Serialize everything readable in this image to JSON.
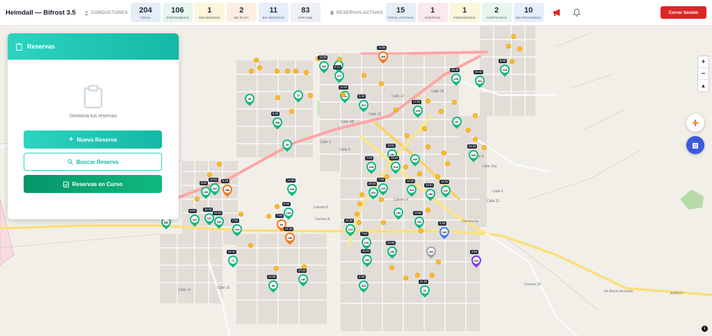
{
  "header": {
    "title": "Heimdall — Bifrost 3.5",
    "drivers_label": "CONDUCTORES",
    "reservations_label": "RESERVAS ACTIVAS",
    "driver_stats": [
      {
        "value": "204",
        "label": "TOTAL",
        "color": "#e5edf7"
      },
      {
        "value": "106",
        "label": "DISPONIBLES",
        "color": "#e6f6ec"
      },
      {
        "value": "1",
        "label": "RECIBIENDO",
        "color": "#fbf6dc"
      },
      {
        "value": "2",
        "label": "EN RUTA",
        "color": "#fdeee2"
      },
      {
        "value": "11",
        "label": "EN SERVICIO",
        "color": "#e6edfb"
      },
      {
        "value": "83",
        "label": "OFFLINE",
        "color": "#eef0f3"
      }
    ],
    "reservation_stats": [
      {
        "value": "15",
        "label": "TOTAL ACTIVAS",
        "color": "#e5edf7"
      },
      {
        "value": "1",
        "label": "OFERTAS",
        "color": "#fbe7ee"
      },
      {
        "value": "1",
        "label": "PENDIENTES",
        "color": "#fbf6dc"
      },
      {
        "value": "2",
        "label": "ACEPTADAS",
        "color": "#e6f6ec"
      },
      {
        "value": "10",
        "label": "EN PROGRESO",
        "color": "#e6edfb"
      }
    ],
    "logout_label": "Cerrar Sesión"
  },
  "panel": {
    "title": "Reservas",
    "subtitle": "Gestiona tus reservas",
    "new_label": "Nueva Reserva",
    "search_label": "Buscar Reserva",
    "progress_label": "Reservas en Curso"
  },
  "map": {
    "zoom_in": "+",
    "zoom_out": "−",
    "north": "▲",
    "attribution": "i",
    "road_labels": [
      "Carrera 8",
      "Carrera 6",
      "Carrera 4",
      "Calle 5",
      "Calle 17",
      "Calle 12",
      "Calle 18",
      "Calle 4B",
      "Calle 3",
      "Calle 6",
      "Calle 15a",
      "Carrera 5a",
      "Calle 8",
      "ASHL07",
      "Via Barrio Acevedo",
      "Carrera 20",
      "Calle 14",
      "Calle 16",
      "Calle 31"
    ],
    "pins": [
      {
        "label": "96",
        "color": "#10b981",
        "tag": ""
      },
      {
        "label": "29",
        "color": "#10b981",
        "tag": ""
      },
      {
        "label": "355",
        "color": "#10b981",
        "tag": "8:20"
      },
      {
        "label": "72",
        "color": "#10b981",
        "tag": ""
      },
      {
        "label": "340",
        "color": "#10b981",
        "tag": "15:00"
      },
      {
        "label": "377",
        "color": "#10b981",
        "tag": "0:21"
      },
      {
        "label": "308",
        "color": "#f97316",
        "tag": "14:05"
      },
      {
        "label": "364",
        "color": "#10b981",
        "tag": "11:03"
      },
      {
        "label": "322",
        "color": "#10b981",
        "tag": "5:02"
      },
      {
        "label": "225",
        "color": "#10b981",
        "tag": "17:01"
      },
      {
        "label": "128",
        "color": "#10b981",
        "tag": "29:49"
      },
      {
        "label": "331",
        "color": "#10b981",
        "tag": "25:11"
      },
      {
        "label": "118",
        "color": "#10b981",
        "tag": "8:55"
      },
      {
        "label": "83",
        "color": "#10b981",
        "tag": ""
      },
      {
        "label": "346",
        "color": "#10b981",
        "tag": "25:32"
      },
      {
        "label": "258",
        "color": "#10b981",
        "tag": "13:01"
      },
      {
        "label": "312",
        "color": "#10b981",
        "tag": "14:02"
      },
      {
        "label": "230",
        "color": "#10b981",
        "tag": "18:01"
      },
      {
        "label": "335",
        "color": "#10b981",
        "tag": ""
      },
      {
        "label": "319",
        "color": "#10b981",
        "tag": "18:02"
      },
      {
        "label": "228",
        "color": "#10b981",
        "tag": "7:04"
      },
      {
        "label": "229",
        "color": "#10b981",
        "tag": "7:04"
      },
      {
        "label": "323",
        "color": "#10b981",
        "tag": "12:30"
      },
      {
        "label": "150",
        "color": "#10b981",
        "tag": ""
      },
      {
        "label": "253",
        "color": "#10b981",
        "tag": "14:53"
      },
      {
        "label": "305",
        "color": "#3b82f6",
        "tag": "4:30"
      },
      {
        "label": "254",
        "color": "#7c3aed",
        "tag": "3:56"
      },
      {
        "label": "262",
        "color": "#9ca3af",
        "tag": ""
      },
      {
        "label": "240",
        "color": "#10b981",
        "tag": "16:00"
      },
      {
        "label": "213",
        "color": "#10b981",
        "tag": "10:30"
      },
      {
        "label": "228",
        "color": "#10b981",
        "tag": "7:02"
      },
      {
        "label": "156",
        "color": "#10b981",
        "tag": "43:01"
      },
      {
        "label": "318",
        "color": "#10b981",
        "tag": "2:39"
      },
      {
        "label": "16",
        "color": "#10b981",
        "tag": "41:02"
      },
      {
        "label": "104",
        "color": "#10b981",
        "tag": "7:02"
      },
      {
        "label": "186",
        "color": "#f97316",
        "tag": "21:15"
      },
      {
        "label": "66",
        "color": "#f97316",
        "tag": "7:00"
      },
      {
        "label": "193",
        "color": "#10b981",
        "tag": "8:40"
      },
      {
        "label": "236",
        "color": "#10b981",
        "tag": "14:00"
      },
      {
        "label": "288",
        "color": "#f97316",
        "tag": "8:19"
      },
      {
        "label": "320",
        "color": "#10b981",
        "tag": "10:01"
      },
      {
        "label": "166",
        "color": "#10b981",
        "tag": "6:52"
      },
      {
        "label": "147",
        "color": "#10b981",
        "tag": "6:00"
      },
      {
        "label": "237",
        "color": "#10b981",
        "tag": "15:32"
      },
      {
        "label": "189",
        "color": "#10b981",
        "tag": "22:03"
      },
      {
        "label": "282",
        "color": "#10b981",
        "tag": ""
      },
      {
        "label": "71",
        "color": "#10b981",
        "tag": "14:11"
      },
      {
        "label": "89",
        "color": "#10b981",
        "tag": "24:08"
      },
      {
        "label": "180",
        "color": "#10b981",
        "tag": "20:36"
      },
      {
        "label": "17",
        "color": "#10b981",
        "tag": ""
      },
      {
        "label": "322",
        "color": "#10b981",
        "tag": "29:03"
      }
    ]
  }
}
